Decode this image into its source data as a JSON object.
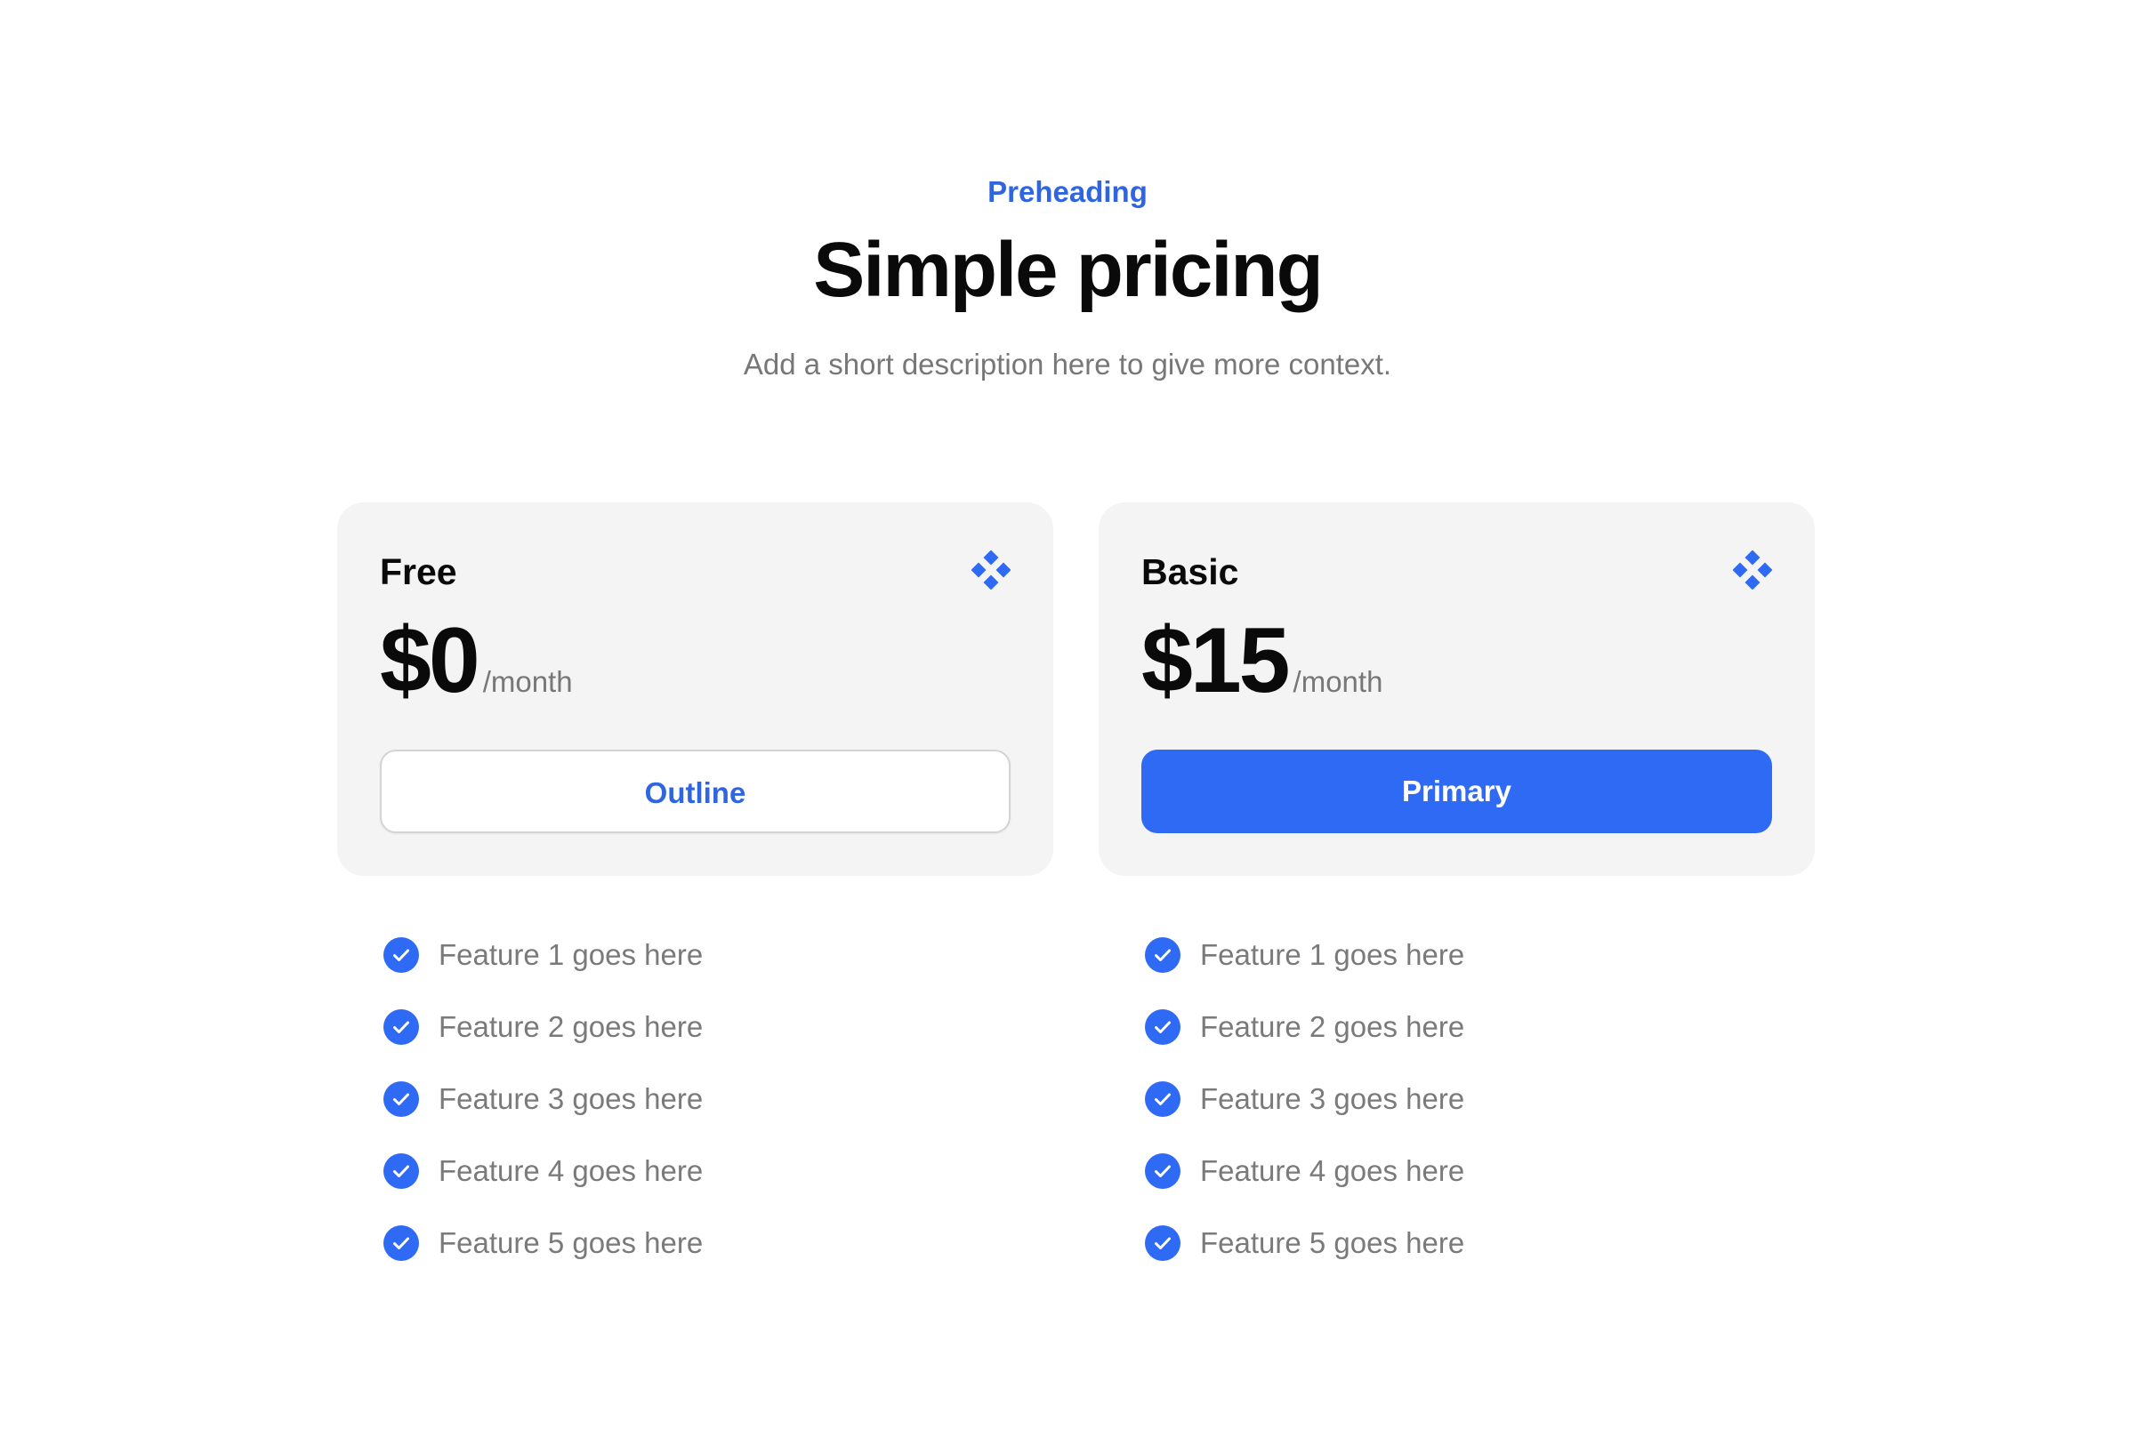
{
  "header": {
    "preheading": "Preheading",
    "title": "Simple pricing",
    "description": "Add a short description here to give more context."
  },
  "colors": {
    "accent": "#2f6af5",
    "accent_text": "#2f66e0",
    "card_background": "#f4f4f4",
    "muted_text": "#777777"
  },
  "plans": [
    {
      "name": "Free",
      "icon": "diamond-cluster-icon",
      "price": "$0",
      "period": "/month",
      "button_label": "Outline",
      "button_style": "outline",
      "features": [
        "Feature 1 goes here",
        "Feature 2 goes here",
        "Feature 3 goes here",
        "Feature 4 goes here",
        "Feature 5 goes here"
      ]
    },
    {
      "name": "Basic",
      "icon": "diamond-cluster-icon",
      "price": "$15",
      "period": "/month",
      "button_label": "Primary",
      "button_style": "primary",
      "features": [
        "Feature 1 goes here",
        "Feature 2 goes here",
        "Feature 3 goes here",
        "Feature 4 goes here",
        "Feature 5 goes here"
      ]
    }
  ]
}
